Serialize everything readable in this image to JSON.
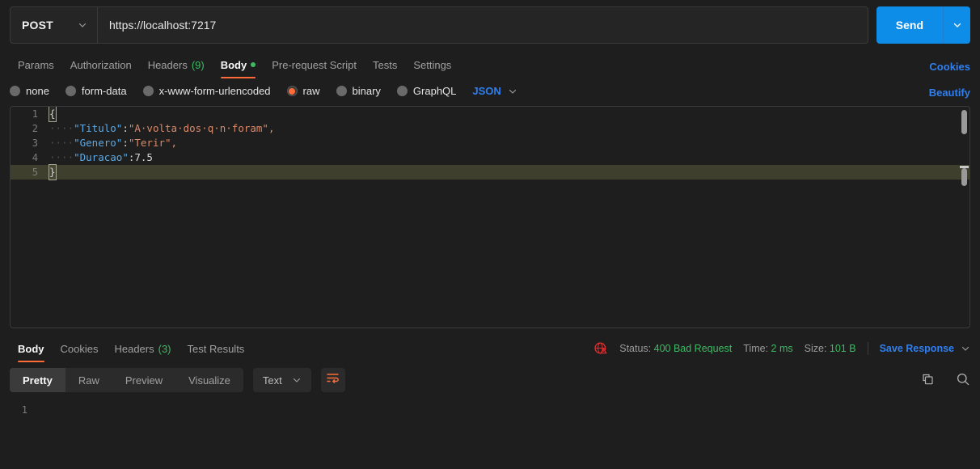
{
  "request": {
    "method": "POST",
    "url_prefix": "https://localhost:",
    "url_port": "7217",
    "send_label": "Send",
    "tabs": [
      {
        "label": "Params",
        "count": "",
        "active": false,
        "dot": false
      },
      {
        "label": "Authorization",
        "count": "",
        "active": false,
        "dot": false
      },
      {
        "label": "Headers",
        "count": "(9)",
        "active": false,
        "dot": false
      },
      {
        "label": "Body",
        "count": "",
        "active": true,
        "dot": true
      },
      {
        "label": "Pre-request Script",
        "count": "",
        "active": false,
        "dot": false
      },
      {
        "label": "Tests",
        "count": "",
        "active": false,
        "dot": false
      },
      {
        "label": "Settings",
        "count": "",
        "active": false,
        "dot": false
      }
    ],
    "cookies_link": "Cookies",
    "beautify_link": "Beautify",
    "body_types": [
      {
        "label": "none",
        "selected": false
      },
      {
        "label": "form-data",
        "selected": false
      },
      {
        "label": "x-www-form-urlencoded",
        "selected": false
      },
      {
        "label": "raw",
        "selected": true
      },
      {
        "label": "binary",
        "selected": false
      },
      {
        "label": "GraphQL",
        "selected": false
      }
    ],
    "raw_format": "JSON"
  },
  "editor": {
    "lines": [
      {
        "n": "1",
        "text": "{",
        "active": false
      },
      {
        "n": "2",
        "indent": "····",
        "key": "\"Titulo\"",
        "colon": ":",
        "value": "\"A·volta·dos·q·n·foram\"",
        "tail": ",",
        "value_type": "string",
        "active": false
      },
      {
        "n": "3",
        "indent": "····",
        "key": "\"Genero\"",
        "colon": ":",
        "value": "\"Terir\"",
        "tail": ",",
        "value_type": "string",
        "active": false
      },
      {
        "n": "4",
        "indent": "····",
        "key": "\"Duracao\"",
        "colon": ":",
        "value": "7.5",
        "tail": "",
        "value_type": "number",
        "active": false
      },
      {
        "n": "5",
        "text": "}",
        "active": true
      }
    ]
  },
  "response": {
    "tabs": [
      {
        "label": "Body",
        "count": "",
        "active": true
      },
      {
        "label": "Cookies",
        "count": "",
        "active": false
      },
      {
        "label": "Headers",
        "count": "(3)",
        "active": false
      },
      {
        "label": "Test Results",
        "count": "",
        "active": false
      }
    ],
    "status_label": "Status:",
    "status_value": "400 Bad Request",
    "time_label": "Time:",
    "time_value": "2 ms",
    "size_label": "Size:",
    "size_value": "101 B",
    "save_response": "Save Response",
    "view_modes": [
      {
        "label": "Pretty",
        "active": true
      },
      {
        "label": "Raw",
        "active": false
      },
      {
        "label": "Preview",
        "active": false
      },
      {
        "label": "Visualize",
        "active": false
      }
    ],
    "format": "Text",
    "body_lines": [
      {
        "n": "1",
        "text": ""
      }
    ]
  },
  "colors": {
    "accent": "#ff6c37",
    "link": "#2f7ff0",
    "send": "#0d8ce8",
    "success": "#3dba63",
    "warning": "#e03030"
  }
}
